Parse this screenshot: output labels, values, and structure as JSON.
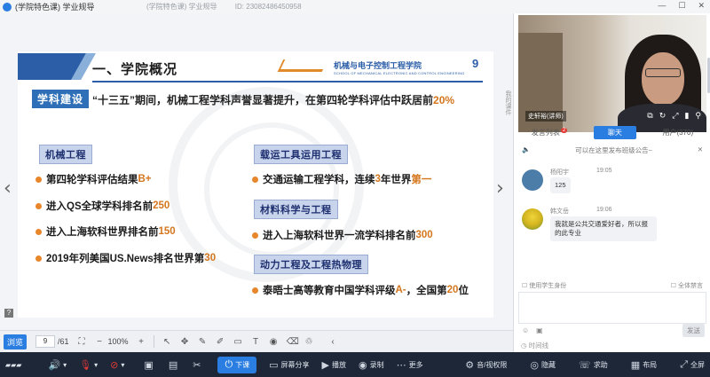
{
  "titlebar": {
    "title": "(学院特色课) 学业规导",
    "course_info": "(学院特色课) 学业规导",
    "id_label": "ID: 23082486450958",
    "minimize": "—",
    "maximize": "☐",
    "close": "✕"
  },
  "slide": {
    "title": "一、学院概况",
    "school_name": "机械与电子控制工程学院",
    "school_en": "SCHOOL OF MECHANICAL ELECTRONIC AND CONTROL ENGINEERING",
    "page_number": "9",
    "section_tag": "学科建设",
    "lead_text": "“十三五”期间，机械工程学科声誉显著提升，在第四轮学科评估中跃居前",
    "lead_highlight": "20%",
    "categories": {
      "mech": "机械工程",
      "transport": "载运工具运用工程",
      "materials": "材料科学与工程",
      "power": "动力工程及工程热物理"
    },
    "items": {
      "mech_1_a": "第四轮学科评估结果",
      "mech_1_b": "B+",
      "mech_2_a": "进入QS全球学科排名前",
      "mech_2_b": "250",
      "mech_3_a": "进入上海软科世界排名前",
      "mech_3_b": "150",
      "mech_4_a": "2019年列美国US.News排名世界第",
      "mech_4_b": "30",
      "trans_1_a": "交通运输工程学科，连续",
      "trans_1_b": "3",
      "trans_1_c": "年世界",
      "trans_1_d": "第一",
      "mat_1_a": "进入上海软科世界一流学科排名前",
      "mat_1_b": "300",
      "pow_1_a": "泰晤士高等教育中国学科评级",
      "pow_1_b": "A-",
      "pow_1_c": "，全国第",
      "pow_1_d": "20",
      "pow_1_e": "位"
    }
  },
  "toolbar": {
    "browse_label": "浏览",
    "current_page": "9",
    "total_pages": "/61",
    "zoom": "100%"
  },
  "side_tab": "我的课件",
  "video": {
    "presenter_name": "史轩裕(讲师)"
  },
  "tabs": {
    "speakers": "发言列表",
    "speakers_badge": "2",
    "chat": "聊天",
    "users": "用户(370)"
  },
  "chat": {
    "notice": "可以在这里发布班级公告~",
    "messages": [
      {
        "name": "杨阳宇",
        "time": "19:05",
        "text": "125"
      },
      {
        "name": "韩文岳",
        "time": "19:06",
        "text": "我就是公共交通爱好者，所以报的此专业"
      }
    ],
    "use_student_id": "使用学生身份",
    "mute_all": "全体禁言",
    "send": "发送",
    "timeline": "时间线"
  },
  "bottombar": {
    "start_class": "下课",
    "screen_share": "屏幕分享",
    "play": "播放",
    "record": "录制",
    "more": "更多",
    "mic_permission": "音/视权限",
    "hide": "隐藏",
    "help": "求助",
    "layout": "布局",
    "fullscreen": "全屏"
  }
}
